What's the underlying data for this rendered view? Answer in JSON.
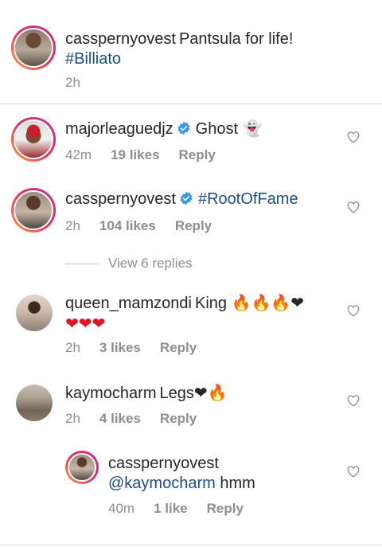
{
  "caption": {
    "username": "casspernyovest",
    "text": "Pantsula for life!",
    "hashtag": "#Billiato",
    "time": "2h"
  },
  "comments": [
    {
      "username": "majorleaguedjz",
      "verified": true,
      "text": "Ghost",
      "emoji": "👻",
      "time": "42m",
      "likes": "19 likes",
      "reply": "Reply"
    },
    {
      "username": "casspernyovest",
      "verified": true,
      "text": "#RootOfFame",
      "time": "2h",
      "likes": "104 likes",
      "reply": "Reply"
    },
    {
      "username": "queen_mamzondi",
      "text": "King",
      "emoji_line1": "🔥🔥🔥❤",
      "emoji_line2": "❤❤❤",
      "time": "2h",
      "likes": "3 likes",
      "reply": "Reply"
    },
    {
      "username": "kaymocharm",
      "text": "Legs",
      "emoji": "❤🔥",
      "time": "2h",
      "likes": "4 likes",
      "reply": "Reply"
    },
    {
      "username": "casspernyovest",
      "mention": "@kaymocharm",
      "text": "hmm",
      "time": "40m",
      "likes": "1 like",
      "reply": "Reply"
    }
  ],
  "view_replies": "View 6 replies",
  "icons": {
    "heart": "heart-outline-icon",
    "verified": "verified-badge-icon"
  },
  "colors": {
    "link": "#1b4e85",
    "muted": "#8e8e8e",
    "verified": "#3897f0"
  }
}
